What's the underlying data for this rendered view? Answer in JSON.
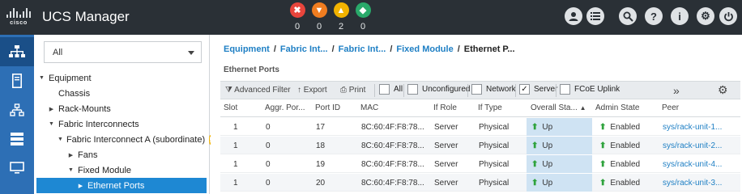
{
  "header": {
    "logo_text": "cisco",
    "app_title": "UCS Manager",
    "faults": [
      {
        "name": "critical",
        "glyph": "✖",
        "color": "#e8453c",
        "count": "0"
      },
      {
        "name": "major",
        "glyph": "▼",
        "color": "#f07d20",
        "count": "0"
      },
      {
        "name": "minor",
        "glyph": "▲",
        "color": "#f2b300",
        "count": "2"
      },
      {
        "name": "warning",
        "glyph": "◆",
        "color": "#29a96a",
        "count": "0"
      }
    ],
    "icons": [
      "user-icon",
      "list-icon",
      "search-icon",
      "help-icon",
      "info-icon",
      "settings-icon",
      "power-icon"
    ]
  },
  "sidebar": {
    "icons": [
      "equipment-icon",
      "servers-icon",
      "lan-icon",
      "storage-icon",
      "vm-icon"
    ]
  },
  "nav": {
    "filter_value": "All",
    "tree": [
      {
        "label": "Equipment",
        "toggle": "▼"
      },
      {
        "label": "Chassis",
        "toggle": ""
      },
      {
        "label": "Rack-Mounts",
        "toggle": "▶"
      },
      {
        "label": "Fabric Interconnects",
        "toggle": "▼"
      },
      {
        "label": "Fabric Interconnect A (subordinate)",
        "toggle": "▼"
      },
      {
        "label": "Fans",
        "toggle": "▶"
      },
      {
        "label": "Fixed Module",
        "toggle": "▼"
      },
      {
        "label": "Ethernet Ports",
        "toggle": "▶"
      }
    ]
  },
  "breadcrumb": {
    "items": [
      "Equipment",
      "Fabric Int...",
      "Fabric Int...",
      "Fixed Module"
    ],
    "current": "Ethernet P..."
  },
  "section_title": "Ethernet Ports",
  "toolbar": {
    "advanced_filter": "Advanced Filter",
    "export": "Export",
    "print": "Print",
    "filters": [
      {
        "label": "All",
        "checked": false
      },
      {
        "label": "Unconfigured",
        "checked": false
      },
      {
        "label": "Network",
        "checked": false
      },
      {
        "label": "Server",
        "checked": true
      },
      {
        "label": "FCoE Uplink",
        "checked": false
      }
    ],
    "more": "»",
    "settings": "⚙"
  },
  "table": {
    "columns": [
      "Slot",
      "Aggr. Por...",
      "Port ID",
      "MAC",
      "If Role",
      "If Type",
      "Overall Sta...",
      "Admin State",
      "Peer"
    ],
    "sort_indicator": "▲",
    "rows": [
      {
        "slot": "1",
        "aggr": "0",
        "port_id": "17",
        "mac": "8C:60:4F:F8:78...",
        "if_role": "Server",
        "if_type": "Physical",
        "overall": "Up",
        "admin": "Enabled",
        "peer": "sys/rack-unit-1..."
      },
      {
        "slot": "1",
        "aggr": "0",
        "port_id": "18",
        "mac": "8C:60:4F:F8:78...",
        "if_role": "Server",
        "if_type": "Physical",
        "overall": "Up",
        "admin": "Enabled",
        "peer": "sys/rack-unit-2..."
      },
      {
        "slot": "1",
        "aggr": "0",
        "port_id": "19",
        "mac": "8C:60:4F:F8:78...",
        "if_role": "Server",
        "if_type": "Physical",
        "overall": "Up",
        "admin": "Enabled",
        "peer": "sys/rack-unit-4..."
      },
      {
        "slot": "1",
        "aggr": "0",
        "port_id": "20",
        "mac": "8C:60:4F:F8:78...",
        "if_role": "Server",
        "if_type": "Physical",
        "overall": "Up",
        "admin": "Enabled",
        "peer": "sys/rack-unit-3..."
      }
    ]
  }
}
